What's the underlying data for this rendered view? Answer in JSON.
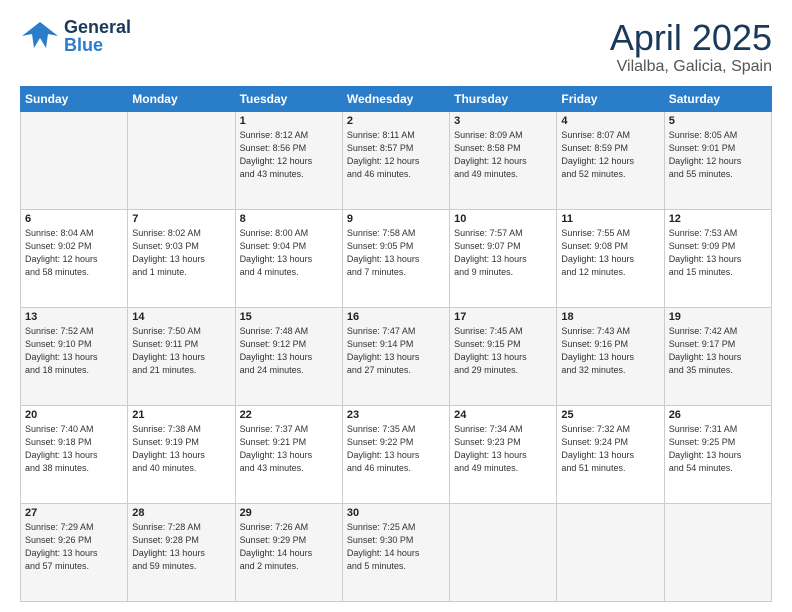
{
  "header": {
    "logo_general": "General",
    "logo_blue": "Blue",
    "title": "April 2025",
    "location": "Vilalba, Galicia, Spain"
  },
  "weekdays": [
    "Sunday",
    "Monday",
    "Tuesday",
    "Wednesday",
    "Thursday",
    "Friday",
    "Saturday"
  ],
  "weeks": [
    [
      {
        "num": "",
        "info": ""
      },
      {
        "num": "",
        "info": ""
      },
      {
        "num": "1",
        "info": "Sunrise: 8:12 AM\nSunset: 8:56 PM\nDaylight: 12 hours\nand 43 minutes."
      },
      {
        "num": "2",
        "info": "Sunrise: 8:11 AM\nSunset: 8:57 PM\nDaylight: 12 hours\nand 46 minutes."
      },
      {
        "num": "3",
        "info": "Sunrise: 8:09 AM\nSunset: 8:58 PM\nDaylight: 12 hours\nand 49 minutes."
      },
      {
        "num": "4",
        "info": "Sunrise: 8:07 AM\nSunset: 8:59 PM\nDaylight: 12 hours\nand 52 minutes."
      },
      {
        "num": "5",
        "info": "Sunrise: 8:05 AM\nSunset: 9:01 PM\nDaylight: 12 hours\nand 55 minutes."
      }
    ],
    [
      {
        "num": "6",
        "info": "Sunrise: 8:04 AM\nSunset: 9:02 PM\nDaylight: 12 hours\nand 58 minutes."
      },
      {
        "num": "7",
        "info": "Sunrise: 8:02 AM\nSunset: 9:03 PM\nDaylight: 13 hours\nand 1 minute."
      },
      {
        "num": "8",
        "info": "Sunrise: 8:00 AM\nSunset: 9:04 PM\nDaylight: 13 hours\nand 4 minutes."
      },
      {
        "num": "9",
        "info": "Sunrise: 7:58 AM\nSunset: 9:05 PM\nDaylight: 13 hours\nand 7 minutes."
      },
      {
        "num": "10",
        "info": "Sunrise: 7:57 AM\nSunset: 9:07 PM\nDaylight: 13 hours\nand 9 minutes."
      },
      {
        "num": "11",
        "info": "Sunrise: 7:55 AM\nSunset: 9:08 PM\nDaylight: 13 hours\nand 12 minutes."
      },
      {
        "num": "12",
        "info": "Sunrise: 7:53 AM\nSunset: 9:09 PM\nDaylight: 13 hours\nand 15 minutes."
      }
    ],
    [
      {
        "num": "13",
        "info": "Sunrise: 7:52 AM\nSunset: 9:10 PM\nDaylight: 13 hours\nand 18 minutes."
      },
      {
        "num": "14",
        "info": "Sunrise: 7:50 AM\nSunset: 9:11 PM\nDaylight: 13 hours\nand 21 minutes."
      },
      {
        "num": "15",
        "info": "Sunrise: 7:48 AM\nSunset: 9:12 PM\nDaylight: 13 hours\nand 24 minutes."
      },
      {
        "num": "16",
        "info": "Sunrise: 7:47 AM\nSunset: 9:14 PM\nDaylight: 13 hours\nand 27 minutes."
      },
      {
        "num": "17",
        "info": "Sunrise: 7:45 AM\nSunset: 9:15 PM\nDaylight: 13 hours\nand 29 minutes."
      },
      {
        "num": "18",
        "info": "Sunrise: 7:43 AM\nSunset: 9:16 PM\nDaylight: 13 hours\nand 32 minutes."
      },
      {
        "num": "19",
        "info": "Sunrise: 7:42 AM\nSunset: 9:17 PM\nDaylight: 13 hours\nand 35 minutes."
      }
    ],
    [
      {
        "num": "20",
        "info": "Sunrise: 7:40 AM\nSunset: 9:18 PM\nDaylight: 13 hours\nand 38 minutes."
      },
      {
        "num": "21",
        "info": "Sunrise: 7:38 AM\nSunset: 9:19 PM\nDaylight: 13 hours\nand 40 minutes."
      },
      {
        "num": "22",
        "info": "Sunrise: 7:37 AM\nSunset: 9:21 PM\nDaylight: 13 hours\nand 43 minutes."
      },
      {
        "num": "23",
        "info": "Sunrise: 7:35 AM\nSunset: 9:22 PM\nDaylight: 13 hours\nand 46 minutes."
      },
      {
        "num": "24",
        "info": "Sunrise: 7:34 AM\nSunset: 9:23 PM\nDaylight: 13 hours\nand 49 minutes."
      },
      {
        "num": "25",
        "info": "Sunrise: 7:32 AM\nSunset: 9:24 PM\nDaylight: 13 hours\nand 51 minutes."
      },
      {
        "num": "26",
        "info": "Sunrise: 7:31 AM\nSunset: 9:25 PM\nDaylight: 13 hours\nand 54 minutes."
      }
    ],
    [
      {
        "num": "27",
        "info": "Sunrise: 7:29 AM\nSunset: 9:26 PM\nDaylight: 13 hours\nand 57 minutes."
      },
      {
        "num": "28",
        "info": "Sunrise: 7:28 AM\nSunset: 9:28 PM\nDaylight: 13 hours\nand 59 minutes."
      },
      {
        "num": "29",
        "info": "Sunrise: 7:26 AM\nSunset: 9:29 PM\nDaylight: 14 hours\nand 2 minutes."
      },
      {
        "num": "30",
        "info": "Sunrise: 7:25 AM\nSunset: 9:30 PM\nDaylight: 14 hours\nand 5 minutes."
      },
      {
        "num": "",
        "info": ""
      },
      {
        "num": "",
        "info": ""
      },
      {
        "num": "",
        "info": ""
      }
    ]
  ]
}
